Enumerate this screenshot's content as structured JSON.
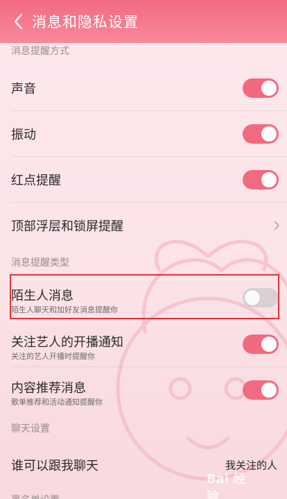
{
  "header": {
    "title": "消息和隐私设置"
  },
  "sections": {
    "method": "消息提醒方式",
    "type": "消息提醒类型",
    "chat": "聊天设置",
    "bottom_partial": "黑名单设置"
  },
  "rows": {
    "sound": {
      "label": "声音",
      "enabled": true
    },
    "vibrate": {
      "label": "振动",
      "enabled": true
    },
    "red_dot": {
      "label": "红点提醒",
      "enabled": true
    },
    "float_lock": {
      "label": "顶部浮层和锁屏提醒"
    },
    "stranger": {
      "label": "陌生人消息",
      "desc": "陌生人聊天和加好友消息提醒你",
      "enabled": false
    },
    "artist": {
      "label": "关注艺人的开播通知",
      "desc": "关注的艺人开播时提醒你",
      "enabled": true
    },
    "recommend": {
      "label": "内容推荐消息",
      "desc": "歌单推荐和活动通知提醒你",
      "enabled": true
    },
    "who_chat": {
      "label": "谁可以跟我聊天",
      "value": "我关注的人"
    }
  },
  "watermark": "Bai 经验",
  "colors": {
    "accent": "#f26a80",
    "header": "#f26a82",
    "highlight": "#e0313b"
  }
}
